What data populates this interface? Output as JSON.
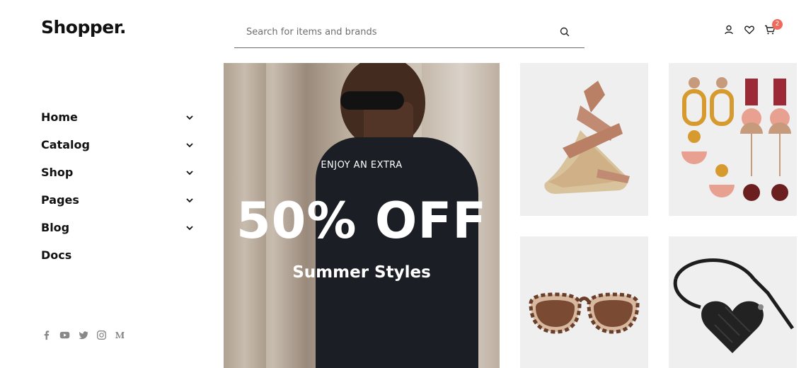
{
  "brand": {
    "logo": "Shopper."
  },
  "search": {
    "placeholder": "Search for items and brands"
  },
  "header": {
    "cart_count": "2"
  },
  "nav": {
    "items": [
      {
        "label": "Home"
      },
      {
        "label": "Catalog"
      },
      {
        "label": "Shop"
      },
      {
        "label": "Pages"
      },
      {
        "label": "Blog"
      },
      {
        "label": "Docs"
      }
    ]
  },
  "hero": {
    "kicker": "ENJOY AN EXTRA",
    "headline": "50% OFF",
    "subheadline": "Summer Styles"
  },
  "social": {
    "icons": [
      "facebook-icon",
      "youtube-icon",
      "twitter-icon",
      "instagram-icon",
      "medium-icon"
    ]
  },
  "colors": {
    "accent": "#f06a5c",
    "text": "#111111",
    "muted": "#888888",
    "tile_bg": "#ececec"
  }
}
